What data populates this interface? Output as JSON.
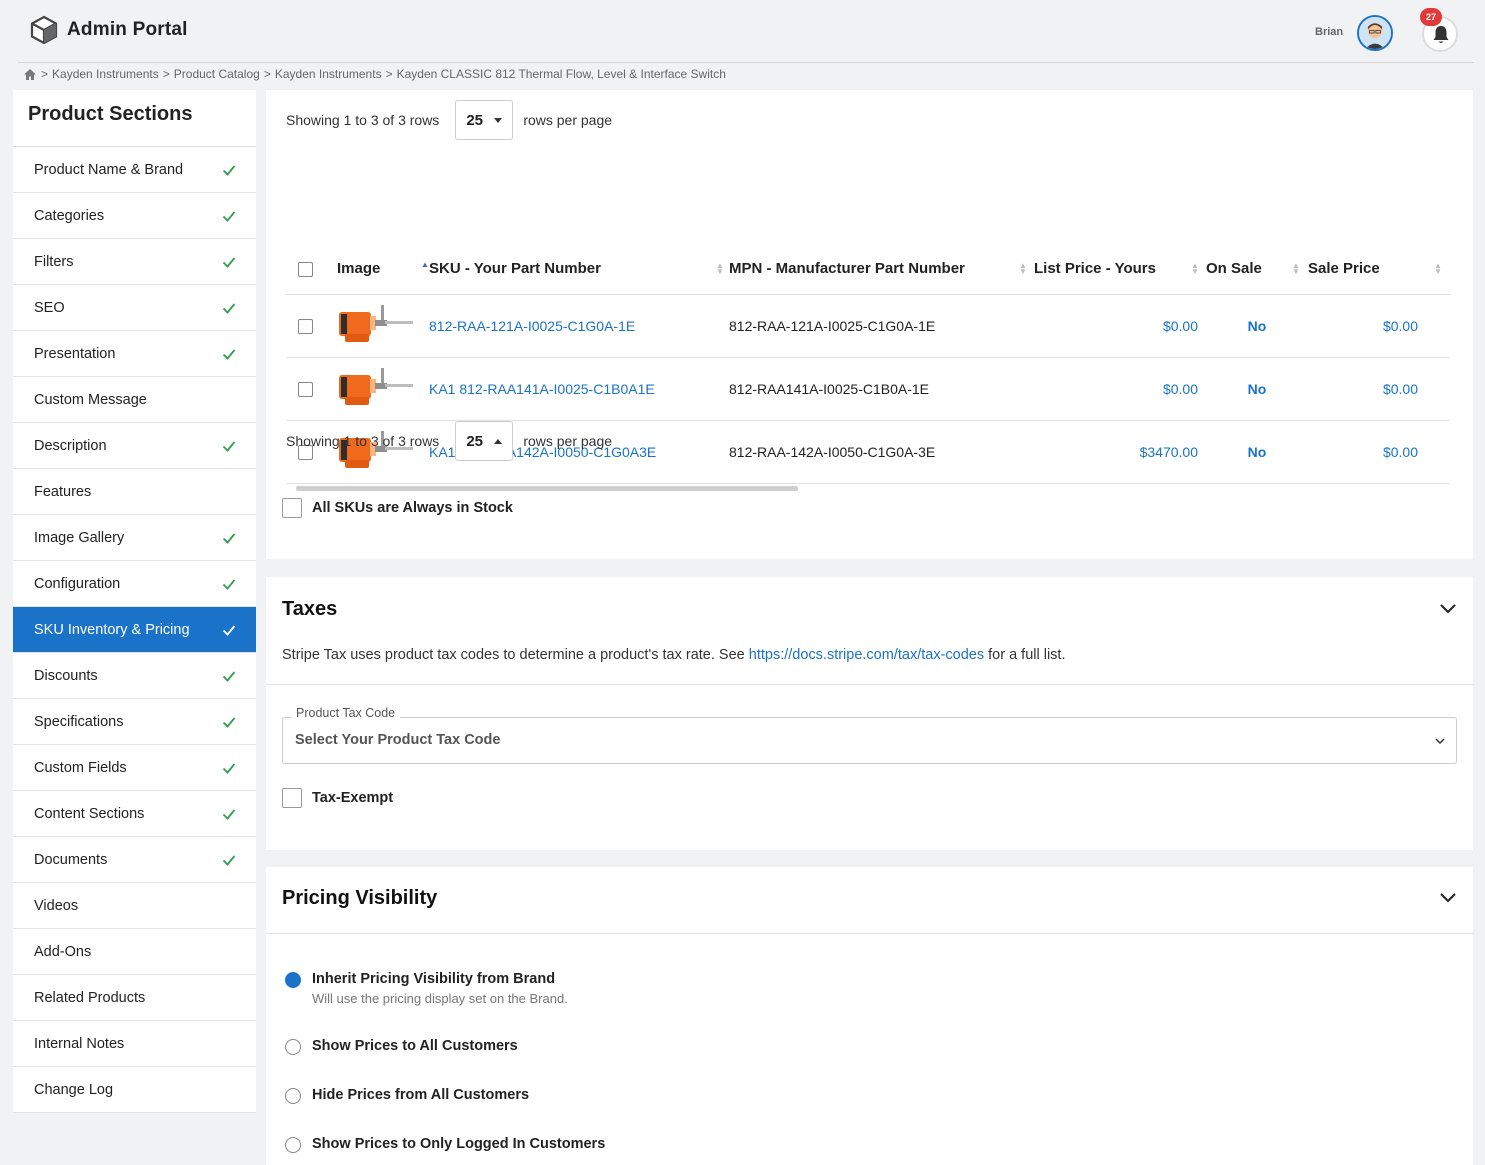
{
  "header": {
    "title": "Admin Portal",
    "user_name": "Brian",
    "notification_count": "27"
  },
  "breadcrumb": [
    "Kayden Instruments",
    "Product Catalog",
    "Kayden Instruments",
    "Kayden CLASSIC 812 Thermal Flow, Level & Interface Switch"
  ],
  "sidebar": {
    "title": "Product Sections",
    "items": [
      {
        "label": "Product Name & Brand",
        "done": true
      },
      {
        "label": "Categories",
        "done": true
      },
      {
        "label": "Filters",
        "done": true
      },
      {
        "label": "SEO",
        "done": true
      },
      {
        "label": "Presentation",
        "done": true
      },
      {
        "label": "Custom Message",
        "done": false
      },
      {
        "label": "Description",
        "done": true
      },
      {
        "label": "Features",
        "done": false
      },
      {
        "label": "Image Gallery",
        "done": true
      },
      {
        "label": "Configuration",
        "done": true
      },
      {
        "label": "SKU Inventory & Pricing",
        "done": true,
        "active": true
      },
      {
        "label": "Discounts",
        "done": true
      },
      {
        "label": "Specifications",
        "done": true
      },
      {
        "label": "Custom Fields",
        "done": true
      },
      {
        "label": "Content Sections",
        "done": true
      },
      {
        "label": "Documents",
        "done": true
      },
      {
        "label": "Videos",
        "done": false
      },
      {
        "label": "Add-Ons",
        "done": false
      },
      {
        "label": "Related Products",
        "done": false
      },
      {
        "label": "Internal Notes",
        "done": false
      },
      {
        "label": "Change Log",
        "done": false
      }
    ]
  },
  "skus": {
    "showing_text": "Showing 1 to 3 of 3 rows",
    "rows_per_page": "25",
    "rows_per_page_label": "rows per page",
    "columns": [
      "Image",
      "SKU - Your Part Number",
      "MPN - Manufacturer Part Number",
      "List Price - Yours",
      "On Sale",
      "Sale Price"
    ],
    "rows": [
      {
        "sku": "812-RAA-121A-I0025-C1G0A-1E",
        "mpn": "812-RAA-121A-I0025-C1G0A-1E",
        "list_price": "$0.00",
        "on_sale": "No",
        "sale_price": "$0.00"
      },
      {
        "sku": "KA1 812-RAA141A-I0025-C1B0A1E",
        "mpn": "812-RAA141A-I0025-C1B0A-1E",
        "list_price": "$0.00",
        "on_sale": "No",
        "sale_price": "$0.00"
      },
      {
        "sku": "KA1 812-RAA142A-I0050-C1G0A3E",
        "mpn": "812-RAA-142A-I0050-C1G0A-3E",
        "list_price": "$3470.00",
        "on_sale": "No",
        "sale_price": "$0.00"
      }
    ],
    "always_in_stock_label": "All SKUs are Always in Stock"
  },
  "taxes": {
    "title": "Taxes",
    "desc_before": "Stripe Tax uses product tax codes to determine a product's tax rate. See ",
    "desc_link": "https://docs.stripe.com/tax/tax-codes",
    "desc_after": " for a full list.",
    "field_label": "Product Tax Code",
    "field_value": "Select Your Product Tax Code",
    "exempt_label": "Tax-Exempt"
  },
  "pricing": {
    "title": "Pricing Visibility",
    "options": [
      {
        "label": "Inherit Pricing Visibility from Brand",
        "sub": "Will use the pricing display set on the Brand.",
        "selected": true
      },
      {
        "label": "Show Prices to All Customers",
        "sub": "",
        "selected": false
      },
      {
        "label": "Hide Prices from All Customers",
        "sub": "",
        "selected": false
      },
      {
        "label": "Show Prices to Only Logged In Customers",
        "sub": "",
        "selected": false
      }
    ]
  },
  "colors": {
    "accent": "#1a73c8",
    "check": "#2e9e4f",
    "badge": "#e03a3a",
    "product_orange": "#f06a1e"
  }
}
